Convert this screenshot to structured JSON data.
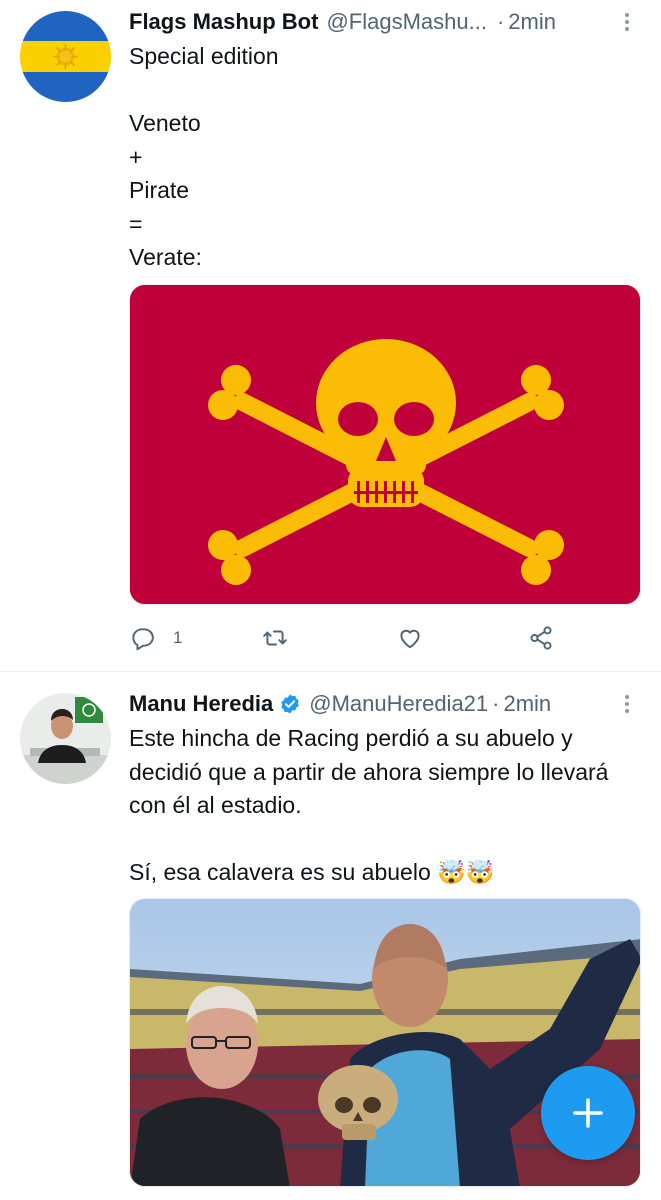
{
  "tweets": [
    {
      "author_name": "Flags Mashup Bot",
      "handle": "@FlagsMashu...",
      "separator": "·",
      "time": "2min",
      "text": "Special edition\n\nVeneto\n+\nPirate\n=\nVerate:",
      "media": "flag-image",
      "actions": {
        "reply_count": "1",
        "retweet_count": "",
        "like_count": ""
      }
    },
    {
      "author_name": "Manu Heredia",
      "verified": true,
      "handle": "@ManuHeredia21",
      "separator": "·",
      "time": "2min",
      "text": "Este hincha de Racing perdió a su abuelo y decidió que a partir de ahora siempre lo llevará con él al estadio.\n\nSí, esa calavera es su abuelo 🤯🤯",
      "media": "stadium-photo"
    }
  ],
  "colors": {
    "accent": "#1d9bf0",
    "flag_red": "#c0003a",
    "flag_gold": "#fbbc05",
    "text_primary": "#0f1419",
    "text_secondary": "#536471"
  },
  "icons": [
    "more-icon",
    "reply-icon",
    "retweet-icon",
    "like-icon",
    "share-icon",
    "verified-icon",
    "compose-plus-icon"
  ]
}
